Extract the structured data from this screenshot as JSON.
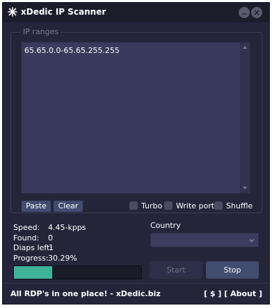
{
  "window": {
    "title": "xDedic IP Scanner",
    "min_symbol": "–",
    "close_symbol": "✕"
  },
  "ip_ranges": {
    "label": "IP ranges",
    "value": "65.65.0.0-65.65.255.255"
  },
  "buttons": {
    "paste": "Paste",
    "clear": "Clear",
    "start": "Start",
    "stop": "Stop"
  },
  "options": [
    {
      "label": "Turbo",
      "checked": false
    },
    {
      "label": "Write port",
      "checked": false
    },
    {
      "label": "Shuffle",
      "checked": false
    }
  ],
  "stats": {
    "speed_label": "Speed:",
    "speed_value": "4.45-kpps",
    "found_label": "Found:",
    "found_value": "0",
    "diaps_label": "Diaps left:",
    "diaps_value": "1",
    "progress_label": "Progress:",
    "progress_value": "30.29%"
  },
  "progress_fraction": 0.3029,
  "country": {
    "label": "Country",
    "selected": ""
  },
  "footer": {
    "left": "All RDP's in one place! - xDedic.biz",
    "right": "[ $ ] [ About ]"
  },
  "colors": {
    "window_bg": "#25253a",
    "accent": "#3fb39a",
    "button_bg": "#414c70"
  }
}
